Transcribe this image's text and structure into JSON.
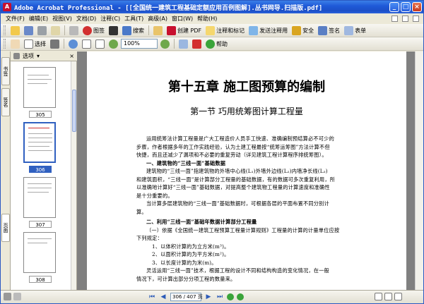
{
  "window": {
    "title": "Adobe Acrobat Professional - [[全国统一建筑工程基础定额应用百例图解].丛书网导.扫描版.pdf]",
    "controls": {
      "minimize": "_",
      "maximize": "□",
      "close": "×"
    }
  },
  "menu": {
    "items": [
      "文件(F)",
      "编辑(E)",
      "视图(V)",
      "文档(D)",
      "注释(C)",
      "工具(T)",
      "高级(A)",
      "窗口(W)",
      "帮助(H)"
    ]
  },
  "toolbar1": {
    "search_label": "搜索",
    "create_pdf_label": "创建 PDF",
    "comment_label": "注释和标记",
    "send_label": "发送注释用",
    "secure_label": "安全",
    "sign_label": "签名",
    "forms_label": "表单",
    "dianshang_label": "图形"
  },
  "toolbar2": {
    "select_label": "选择",
    "zoom_value": "100%",
    "help_label": "帮助"
  },
  "side_tabs": [
    "书签",
    "签名",
    "页面"
  ],
  "panel": {
    "header_label": "选项",
    "thumbnails": [
      {
        "label": "305",
        "selected": false
      },
      {
        "label": "306",
        "selected": true
      },
      {
        "label": "307",
        "selected": false
      },
      {
        "label": "308",
        "selected": false
      }
    ]
  },
  "document": {
    "chapter_title": "第十五章  施工图预算的编制",
    "section_title": "第一节  巧用统筹图计算工程量",
    "lines": [
      "运用统筹法计算工程量是广大工程造价人员手工快速、准确编制预结算必不可少的",
      "步骤，作者根据多年的工作实践经验，认为土建工程最按“统筹运筹图”方法计算不但",
      "快捷，而且还减少了漏项和不必要的重复劳动（详见建筑工程计算程序排统筹图）。",
      "一、建筑物的“三线一面”基础数据",
      "建筑物的“三线一面”指建筑物的外墙中心线(L₁)外墙外边线(L₂)内墙净长线(L₃)",
      "和建筑面积，“三线一面”是计算部分工程量的基础数据，有的数据可多次重复利用，所",
      "以准确地计算好“三线一面”基础数据，对提高整个建筑物工程量的计算速度和准确性",
      "是十分重要的。",
      "当计算多层建筑物的“三线一面”基础数据时，可根据各层的平面布置不同分别计",
      "算。",
      "二、利用“三线一面”基础年数据计算部分工程量",
      "（一）依据《全国统一建筑工程预算工程量计算规则》工程量的计算的计量单位应按",
      "下列规定：",
      "1、以体积计算的为立方米(m³)。",
      "2、以面积计算的为平方米(m²)。",
      "3、以长度计算的为米(m)。",
      "灵活运用“三线一面”技术，根据工程的设计不同和结构构造的变化情况，在一般",
      "情况下，可计算出部分分项工程的数量来。"
    ]
  },
  "status": {
    "page_display": "306 / 407 页"
  },
  "colors": {
    "titlebar": "#1f5ad8",
    "selection": "#3060c0",
    "doc_background": "#808080"
  }
}
